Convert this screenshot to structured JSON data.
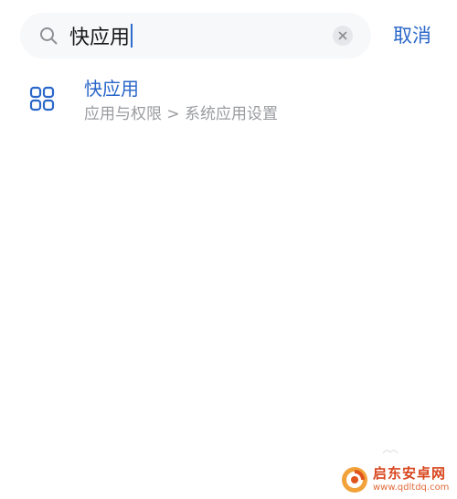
{
  "search": {
    "query": "快应用",
    "cancel_label": "取消"
  },
  "results": [
    {
      "title": "快应用",
      "path": "应用与权限 > 系统应用设置",
      "icon": "grid-apps-icon"
    }
  ],
  "watermark": {
    "title": "启东安卓网",
    "url": "www.qdltdq.com"
  },
  "colors": {
    "accent": "#2a67c9",
    "secondary_text": "#9a9ca0",
    "search_bg": "#f7f8fa",
    "watermark": "#d8461e"
  }
}
